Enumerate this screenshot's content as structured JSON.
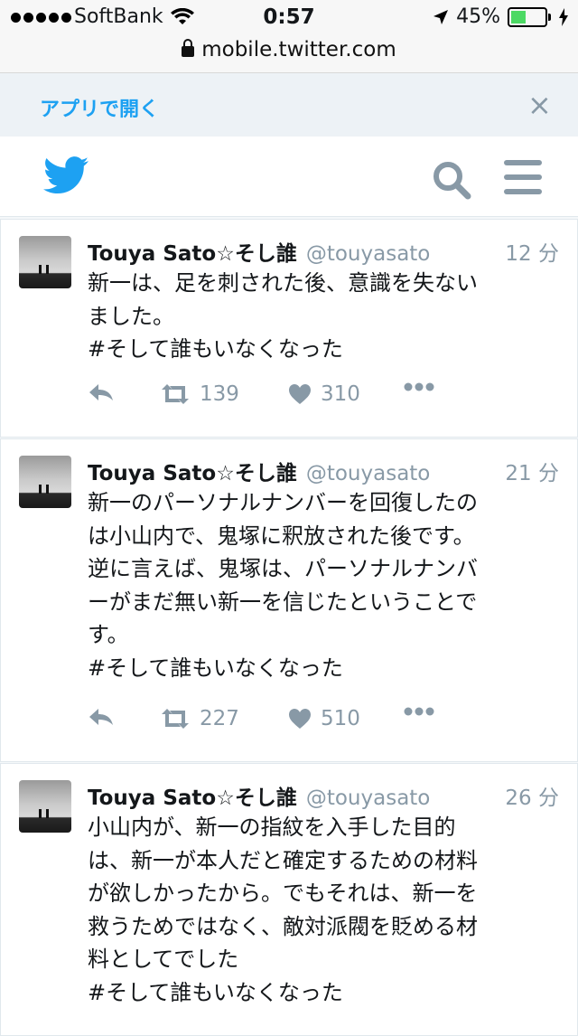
{
  "status_bar": {
    "carrier": "SoftBank",
    "time": "0:57",
    "battery": "45%",
    "url": "mobile.twitter.com"
  },
  "banner": {
    "open_in_app": "アプリで開く",
    "close": "×"
  },
  "tweets": [
    {
      "name": "Touya Sato☆そし誰",
      "handle": "@touyasato",
      "time": "12 分",
      "lines": [
        "新一は、足を刺された後、意識を失ない",
        "ました。",
        "#そして誰もいなくなった"
      ],
      "retweets": "139",
      "likes": "310"
    },
    {
      "name": "Touya Sato☆そし誰",
      "handle": "@touyasato",
      "time": "21 分",
      "lines": [
        "新一のパーソナルナンバーを回復したの",
        "は小山内で、鬼塚に釈放された後です。",
        "逆に言えば、鬼塚は、パーソナルナンバ",
        "ーがまだ無い新一を信じたということで",
        "す。",
        "#そして誰もいなくなった"
      ],
      "retweets": "227",
      "likes": "510"
    },
    {
      "name": "Touya Sato☆そし誰",
      "handle": "@touyasato",
      "time": "26 分",
      "lines": [
        "小山内が、新一の指紋を入手した目的",
        "は、新一が本人だと確定するための材料",
        "が欲しかったから。でもそれは、新一を",
        "救うためではなく、敵対派閥を貶める材",
        "料としてでした",
        "#そして誰もいなくなった"
      ]
    }
  ]
}
